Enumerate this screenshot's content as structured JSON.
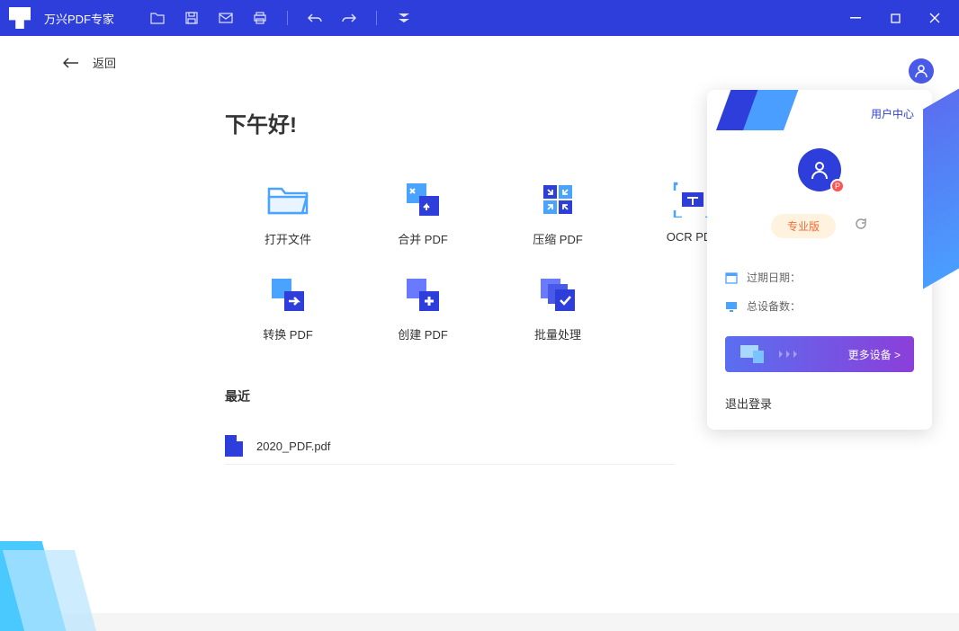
{
  "app": {
    "title": "万兴PDF专家"
  },
  "nav": {
    "back": "返回"
  },
  "greeting": "下午好!",
  "actions": [
    {
      "label": "打开文件"
    },
    {
      "label": "合并 PDF"
    },
    {
      "label": "压缩 PDF"
    },
    {
      "label": "OCR PDF"
    },
    {
      "label": "转换 PDF"
    },
    {
      "label": "创建 PDF"
    },
    {
      "label": "批量处理"
    }
  ],
  "recent": {
    "title": "最近",
    "items": [
      {
        "name": "2020_PDF.pdf"
      }
    ]
  },
  "userPanel": {
    "userCenter": "用户中心",
    "avatarBadge": "P",
    "proBadge": "专业版",
    "expiry": {
      "label": "过期日期：",
      "value": ""
    },
    "devices": {
      "label": "总设备数：",
      "value": ""
    },
    "moreDevices": "更多设备 >",
    "logout": "退出登录"
  }
}
